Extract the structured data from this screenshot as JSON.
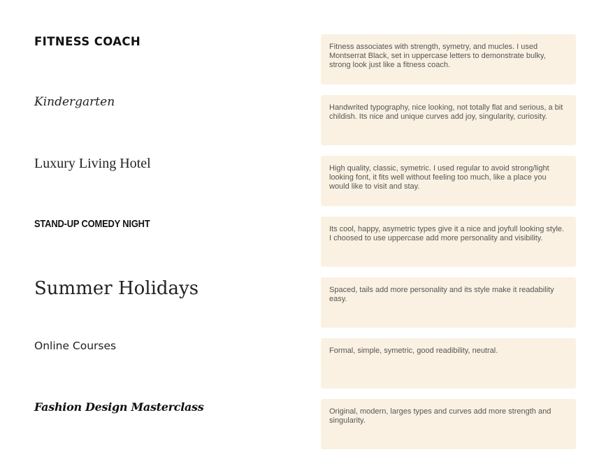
{
  "samples": [
    {
      "label": "FITNESS COACH",
      "description": "Fitness associates with strength, symetry, and mucles. I used Montserrat Black, set in uppercase letters to demonstrate bulky, strong look just like a fitness coach."
    },
    {
      "label": "Kindergarten",
      "description": "Handwrited typography, nice looking, not totally flat and serious, a bit childish. Its nice and unique curves add joy, singularity, curiosity."
    },
    {
      "label": "Luxury Living Hotel",
      "description": "High quality, classic, symetric. I used regular to avoid strong/light looking font, it fits well without feeling too much, like a place you would like to visit and stay."
    },
    {
      "label": "STAND-UP COMEDY NIGHT",
      "description": "Its cool, happy, asymetric types give it a nice and joyfull looking style. I choosed to use uppercase add more personality and visibility."
    },
    {
      "label": "Summer Holidays",
      "description": "Spaced, tails add more personality and its style make it readability easy."
    },
    {
      "label": "Online Courses",
      "description": "Formal, simple, symetric, good readibility, neutral."
    },
    {
      "label": "Fashion Design Masterclass",
      "description": "Original, modern, larges types and curves add more strength and singularity."
    }
  ],
  "colors": {
    "card_background": "#faf1e2",
    "label_text": "#111111",
    "description_text": "#555555"
  }
}
